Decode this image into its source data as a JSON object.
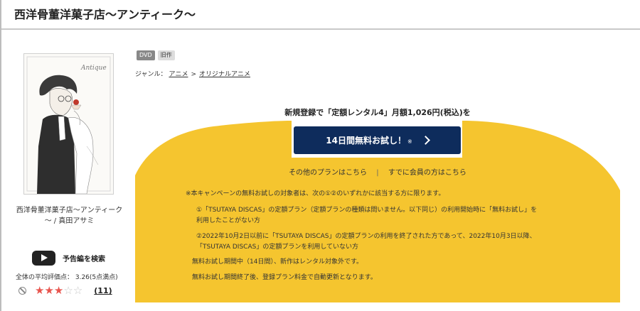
{
  "header": {
    "title": "西洋骨董洋菓子店～アンティーク～"
  },
  "product": {
    "cover_text": "Antique",
    "work_caption_line1": "西洋骨董洋菓子店～アンティーク",
    "work_caption_line2": "～ / 真田アサミ",
    "trailer_label": "予告編を検索",
    "avg_rating_text": "全体の平均評価点： 3.26(5点満点)",
    "rating": 3.26,
    "rating_max": 5,
    "review_count": "(11)"
  },
  "badges": {
    "format": "DVD",
    "status": "旧作"
  },
  "genre": {
    "label": "ジャンル：",
    "items": [
      "アニメ",
      "オリジナルアニメ"
    ],
    "separator": ">"
  },
  "campaign": {
    "headline": "新規登録で「定額レンタル4」月額1,026円(税込)を",
    "button_label": "14日間無料お試し！",
    "button_note": "※",
    "other_plans_link": "その他のプランはこちら",
    "divider": "|",
    "member_link": "すでに会員の方はこちら",
    "notes": [
      "※本キャンペーンの無料お試しの対象者は、次の①②のいずれかに該当する方に限ります。",
      "①「TSUTAYA DISCAS」の定額プラン（定額プランの種類は問いません。以下同じ）の利用開始時に「無料お試し」を",
      "利用したことがない方",
      "②2022年10月2日以前に「TSUTAYA DISCAS」の定額プランの利用を終了された方であって、2022年10月3日以降、",
      "「TSUTAYA DISCAS」の定額プランを利用していない方",
      "無料お試し期間中（14日間）、新作はレンタル対象外です。",
      "無料お試し期間終了後、登録プラン料金で自動更新となります。"
    ]
  },
  "colors": {
    "accent_yellow": "#f5c52f",
    "button_navy": "#0e2c5c",
    "star_red": "#e8554e"
  },
  "icons": {
    "trailer": "youtube-play-icon",
    "no_entry": "ban-icon",
    "chevron": "chevron-right-icon"
  }
}
